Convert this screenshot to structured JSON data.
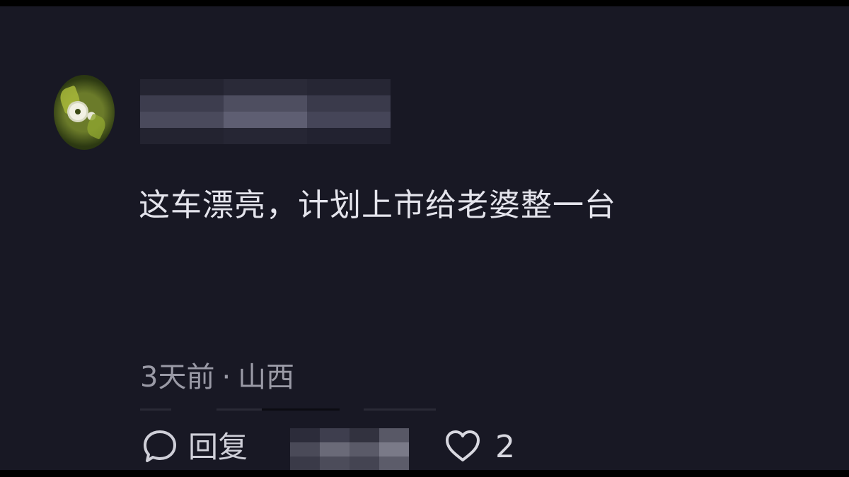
{
  "comment": {
    "text": "这车漂亮，计划上市给老婆整一台",
    "time": "3天前",
    "separator": "·",
    "location": "山西"
  },
  "actions": {
    "reply_icon": "speech-bubble-icon",
    "reply_label": "回复",
    "like_icon": "heart-outline-icon",
    "like_count": "2"
  },
  "colors": {
    "background": "#181824",
    "primary_text": "#e4e4ec",
    "secondary_text": "#9a9aa6"
  }
}
